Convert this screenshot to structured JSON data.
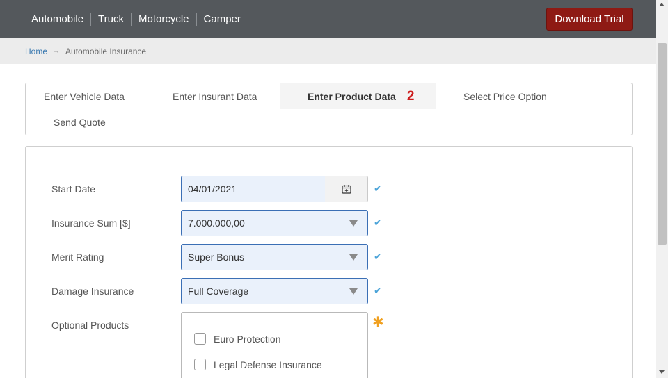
{
  "nav": {
    "items": [
      {
        "label": "Automobile"
      },
      {
        "label": "Truck"
      },
      {
        "label": "Motorcycle"
      },
      {
        "label": "Camper"
      }
    ],
    "download_label": "Download Trial"
  },
  "breadcrumb": {
    "home": "Home",
    "separator": "→",
    "current": "Automobile Insurance"
  },
  "tabs": {
    "items": [
      {
        "label": "Enter Vehicle Data"
      },
      {
        "label": "Enter Insurant Data"
      },
      {
        "label": "Enter Product Data",
        "count": "2",
        "active": true
      },
      {
        "label": "Select Price Option"
      },
      {
        "label": "Send Quote"
      }
    ]
  },
  "form": {
    "start_date": {
      "label": "Start Date",
      "value": "04/01/2021"
    },
    "insurance_sum": {
      "label": "Insurance Sum [$]",
      "value": "7.000.000,00"
    },
    "merit_rating": {
      "label": "Merit Rating",
      "value": "Super Bonus"
    },
    "damage_insurance": {
      "label": "Damage Insurance",
      "value": "Full Coverage"
    },
    "optional_products": {
      "label": "Optional Products",
      "options": [
        {
          "label": "Euro Protection",
          "checked": false
        },
        {
          "label": "Legal Defense Insurance",
          "checked": false
        }
      ]
    },
    "valid_mark": "✔",
    "required_mark": "✱"
  },
  "colors": {
    "topbar": "#54585c",
    "download_button": "#8e1a14",
    "field_border": "#3b6fb5",
    "check": "#4aa3d8",
    "asterisk": "#f0a020",
    "count": "#cc1b1b"
  },
  "icons": {
    "calendar": "calendar-icon",
    "dropdown": "chevron-down-icon",
    "valid": "checkmark-icon",
    "required": "asterisk-icon"
  }
}
